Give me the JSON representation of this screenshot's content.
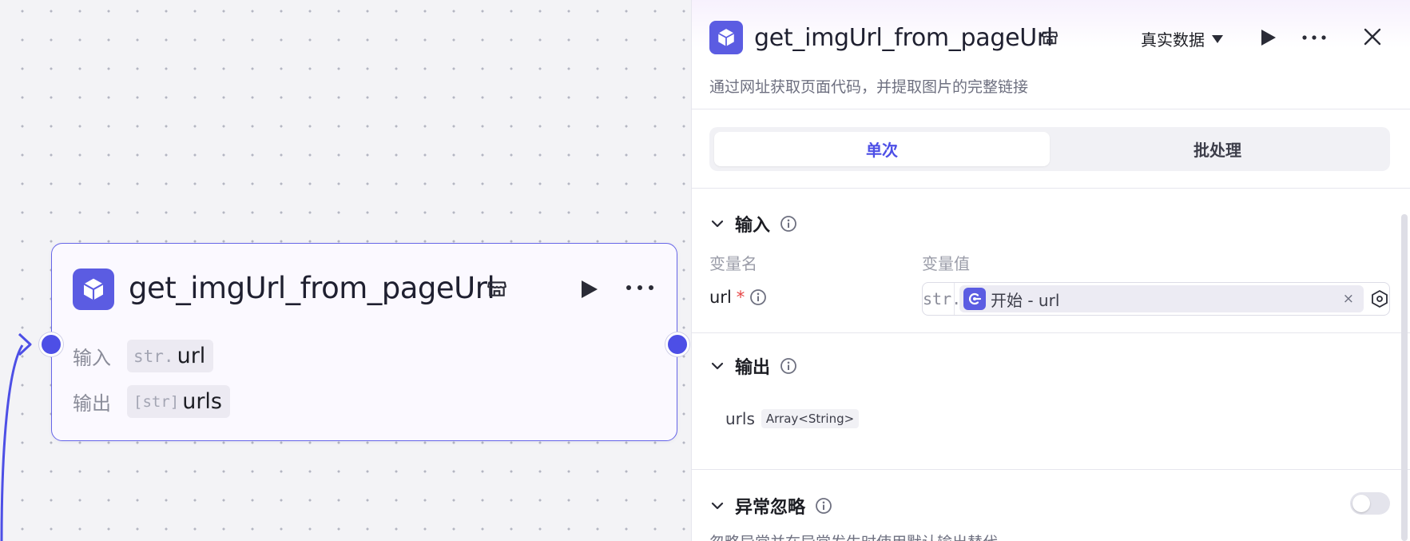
{
  "node": {
    "title": "get_imgUrl_from_pageUrl",
    "input_label": "输入",
    "output_label": "输出",
    "input": {
      "type": "str.",
      "name": "url"
    },
    "output": {
      "type": "[str]",
      "name": "urls"
    }
  },
  "panel": {
    "title": "get_imgUrl_from_pageUrl",
    "data_mode": "真实数据",
    "description": "通过网址获取页面代码，并提取图片的完整链接",
    "tabs": [
      {
        "label": "单次",
        "active": true
      },
      {
        "label": "批处理",
        "active": false
      }
    ],
    "input_section": {
      "title": "输入",
      "col_name": "变量名",
      "col_value": "变量值",
      "var_name": "url",
      "required_mark": "*",
      "var_type": "str.",
      "var_ref": "开始 - url",
      "clear": "×"
    },
    "output_section": {
      "title": "输出",
      "name": "urls",
      "type": "Array<String>"
    },
    "error_section": {
      "title": "异常忽略",
      "enabled": false,
      "description": "忽略异常并在异常发生时使用默认输出替代"
    }
  },
  "colors": {
    "accent": "#4d4fe6",
    "icon_bg": "#5b5ce2",
    "node_border": "#6766e8"
  }
}
